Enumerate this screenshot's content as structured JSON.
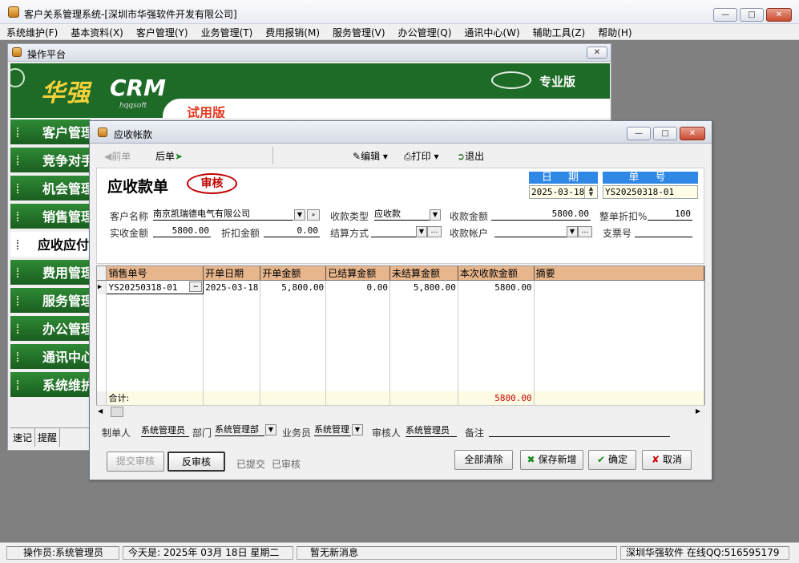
{
  "window": {
    "title": "客户关系管理系统-[深圳市华强软件开发有限公司]"
  },
  "menu": [
    "系统维护(F)",
    "基本资料(X)",
    "客户管理(Y)",
    "业务管理(T)",
    "费用报销(M)",
    "服务管理(V)",
    "办公管理(Q)",
    "通讯中心(W)",
    "辅助工具(Z)",
    "帮助(H)"
  ],
  "platform": {
    "title": "操作平台",
    "logo_cn": "华强",
    "logo_crm": "CRM",
    "logo_sub": "hqqsoft",
    "edition": "专业版",
    "trial": "试用版",
    "nav": [
      "客户管理",
      "竞争对手",
      "机会管理",
      "销售管理",
      "应收应付",
      "费用管理",
      "服务管理",
      "办公管理",
      "通讯中心",
      "系统维护"
    ],
    "tabs": [
      "速记",
      "提醒"
    ]
  },
  "dialog": {
    "title": "应收帐款",
    "toolbar": {
      "prev": "前单",
      "next": "后单",
      "edit": "编辑",
      "print": "打印",
      "exit": "退出"
    },
    "form_title": "应收款单",
    "stamp": "审核",
    "date_label": "日 期",
    "date_value": "2025-03-18",
    "no_label": "单 号",
    "no_value": "YS20250318-01",
    "labels": {
      "customer": "客户名称",
      "recv_type": "收款类型",
      "recv_amount": "收款金额",
      "discount_pct": "整单折扣%",
      "actual": "实收金额",
      "discount_amt": "折扣金额",
      "settle": "结算方式",
      "account": "收款帐户",
      "cheque": "支票号"
    },
    "values": {
      "customer": "南京凯瑞德电气有限公司",
      "recv_type": "应收款",
      "recv_amount": "5800.00",
      "discount_pct": "100",
      "actual": "5800.00",
      "discount_amt": "0.00",
      "settle": "",
      "account": "",
      "cheque": ""
    },
    "grid": {
      "columns": [
        "销售单号",
        "开单日期",
        "开单金额",
        "已结算金额",
        "未结算金额",
        "本次收款金额",
        "摘要"
      ],
      "rows": [
        [
          "YS20250318-01",
          "2025-03-18",
          "5,800.00",
          "0.00",
          "5,800.00",
          "5800.00",
          ""
        ]
      ],
      "total_label": "合计:",
      "total_value": "5800.00"
    },
    "footer": {
      "maker_label": "制单人",
      "maker": "系统管理员",
      "dept_label": "部门",
      "dept": "系统管理部",
      "sales_label": "业务员",
      "sales": "系统管理",
      "auditor_label": "审核人",
      "auditor": "系统管理员",
      "remark_label": "备注",
      "remark": ""
    },
    "buttons": {
      "submit_audit": "提交审核",
      "unaudit": "反审核",
      "submitted": "已提交",
      "audited": "已审核",
      "clear_all": "全部清除",
      "save_new": "保存新增",
      "ok": "确定",
      "cancel": "取消"
    }
  },
  "status": {
    "operator": "操作员:系统管理员",
    "today": "今天是: 2025年 03月 18日  星期二",
    "message": "暂无新消息",
    "company": "深圳华强软件 在线QQ:516595179"
  },
  "colors": {
    "accent_green": "#1e6b28",
    "header_blue": "#2f87e6",
    "grid_header": "#e8b68c",
    "stamp_red": "#c00000"
  }
}
